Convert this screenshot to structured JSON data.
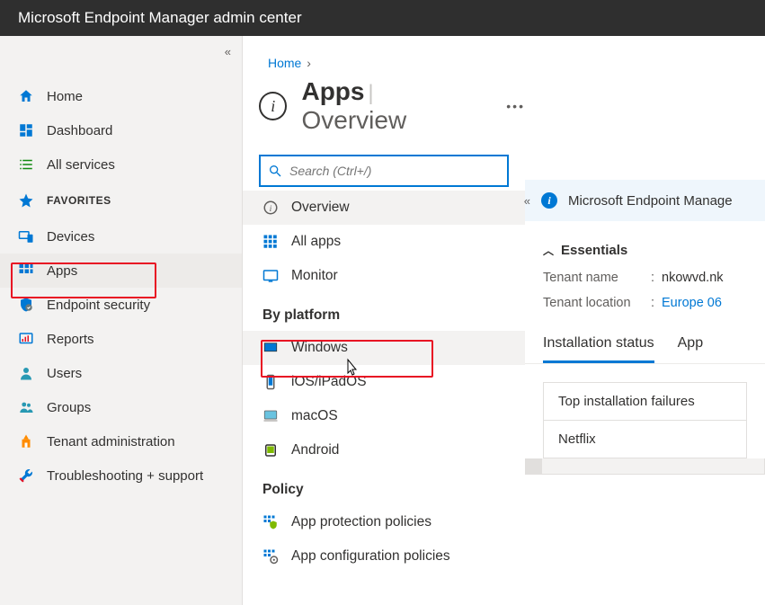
{
  "header": {
    "title": "Microsoft Endpoint Manager admin center"
  },
  "sidebar": {
    "items": [
      {
        "label": "Home"
      },
      {
        "label": "Dashboard"
      },
      {
        "label": "All services"
      }
    ],
    "favorites_label": "FAVORITES",
    "favorites": [
      {
        "label": "Devices"
      },
      {
        "label": "Apps"
      },
      {
        "label": "Endpoint security"
      },
      {
        "label": "Reports"
      },
      {
        "label": "Users"
      },
      {
        "label": "Groups"
      },
      {
        "label": "Tenant administration"
      },
      {
        "label": "Troubleshooting + support"
      }
    ]
  },
  "breadcrumb": {
    "items": [
      "Home"
    ]
  },
  "page": {
    "title": "Apps",
    "subtitle": "Overview"
  },
  "search": {
    "placeholder": "Search (Ctrl+/)"
  },
  "subnav": {
    "top": [
      {
        "label": "Overview"
      },
      {
        "label": "All apps"
      },
      {
        "label": "Monitor"
      }
    ],
    "platform_header": "By platform",
    "platforms": [
      {
        "label": "Windows"
      },
      {
        "label": "iOS/iPadOS"
      },
      {
        "label": "macOS"
      },
      {
        "label": "Android"
      }
    ],
    "policy_header": "Policy",
    "policies": [
      {
        "label": "App protection policies"
      },
      {
        "label": "App configuration policies"
      }
    ]
  },
  "details": {
    "banner": "Microsoft Endpoint Manage",
    "essentials_label": "Essentials",
    "tenant_name_label": "Tenant name",
    "tenant_name_value": "nkowvd.nk",
    "tenant_location_label": "Tenant location",
    "tenant_location_value": "Europe 06",
    "tabs": [
      {
        "label": "Installation status"
      },
      {
        "label": "App"
      }
    ],
    "table_header": "Top installation failures",
    "table_rows": [
      "Netflix"
    ]
  }
}
